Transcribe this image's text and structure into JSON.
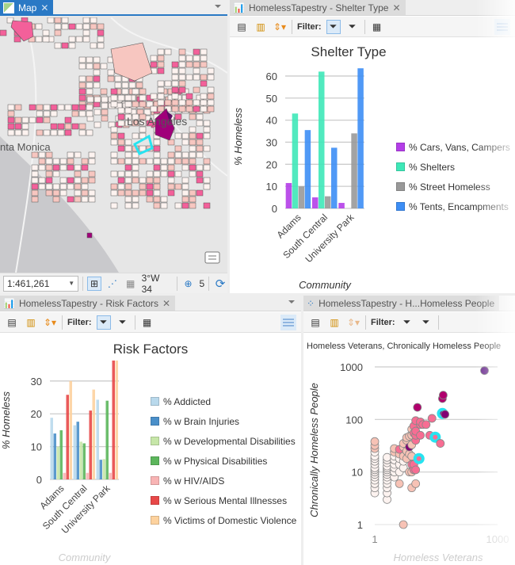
{
  "map_pane": {
    "tab_label": "Map",
    "labels": [
      "Los Angeles",
      "nta Monica"
    ],
    "scale": "1:461,261",
    "coords": "3°W 34",
    "selected_count": "5",
    "colors": {
      "accent": "#2a79c5",
      "selection": "#27e3f0"
    }
  },
  "shelter_pane": {
    "tab_label": "HomelessTapestry - Shelter Type",
    "filter_label": "Filter:",
    "chart_data": {
      "type": "bar",
      "title": "Shelter Type",
      "xlabel": "Community",
      "ylabel": "% Homeless",
      "categories": [
        "Adams",
        "South Central",
        "University Park"
      ],
      "ylim": [
        0,
        65
      ],
      "yticks": [
        "0",
        "10",
        "20",
        "30",
        "40",
        "50",
        "60"
      ],
      "grid": true,
      "legend_position": "right",
      "series": [
        {
          "name": "% Cars, Vans, Campers",
          "color": "#b43ee8",
          "values": [
            11.5,
            5,
            2.5
          ]
        },
        {
          "name": "% Shelters",
          "color": "#3ee8b8",
          "values": [
            43,
            62,
            0
          ]
        },
        {
          "name": "% Street Homeless",
          "color": "#999999",
          "values": [
            10,
            5.5,
            34
          ]
        },
        {
          "name": "% Tents, Encampments",
          "color": "#3d8ef5",
          "values": [
            35.5,
            27.5,
            63.5
          ]
        }
      ]
    }
  },
  "risk_pane": {
    "tab_label": "HomelessTapestry - Risk Factors",
    "filter_label": "Filter:",
    "chart_data": {
      "type": "bar",
      "title": "Risk Factors",
      "xlabel": "Community",
      "ylabel": "% Homeless",
      "categories": [
        "Adams",
        "South Central",
        "University Park"
      ],
      "ylim": [
        0,
        36
      ],
      "yticks": [
        "0",
        "10",
        "20",
        "30"
      ],
      "grid": true,
      "legend_position": "right",
      "series": [
        {
          "name": "% Addicted",
          "color": "#b9d9ec",
          "values": [
            18.8,
            16.5,
            24.3
          ]
        },
        {
          "name": "% w Brain Injuries",
          "color": "#4a8fc9",
          "values": [
            14,
            17.6,
            6
          ]
        },
        {
          "name": "% w Developmental Disabilities",
          "color": "#c6e6a8",
          "values": [
            10,
            11.5,
            6.2
          ]
        },
        {
          "name": "% w Physical Disabilities",
          "color": "#5cb65c",
          "values": [
            15,
            11,
            24
          ]
        },
        {
          "name": "% w HIV/AIDS",
          "color": "#f8b4b4",
          "values": [
            2,
            2,
            2
          ]
        },
        {
          "name": "% w Serious Mental Illnesses",
          "color": "#e84848",
          "values": [
            25.8,
            21,
            37
          ]
        },
        {
          "name": "% Victims of Domestic Violence",
          "color": "#fdd29e",
          "values": [
            30,
            27.4,
            36.8
          ]
        }
      ]
    }
  },
  "scatter_pane": {
    "tab_label": "HomelessTapestry - H...Homeless People",
    "filter_label": "Filter:",
    "chart_data": {
      "type": "scatter",
      "title": "Homeless Veterans, Chronically Homeless People",
      "xlabel": "Homeless Veterans",
      "ylabel": "Chronically Homeless People",
      "xscale": "log",
      "yscale": "log",
      "xlim": [
        1,
        1000
      ],
      "ylim": [
        1,
        1000
      ],
      "xticks": [
        "1",
        "1000"
      ],
      "yticks": [
        "1",
        "10",
        "100",
        "1000"
      ],
      "points": [
        {
          "x": 1,
          "y": 4,
          "c": "#fdf3f0"
        },
        {
          "x": 1,
          "y": 5,
          "c": "#fdf3f0"
        },
        {
          "x": 1,
          "y": 6,
          "c": "#fdf3f0"
        },
        {
          "x": 1,
          "y": 7,
          "c": "#fdf3f0"
        },
        {
          "x": 1,
          "y": 8,
          "c": "#fdf3f0"
        },
        {
          "x": 1,
          "y": 9,
          "c": "#fdf3f0"
        },
        {
          "x": 1,
          "y": 10,
          "c": "#fdf3f0"
        },
        {
          "x": 1,
          "y": 11,
          "c": "#fdf3f0"
        },
        {
          "x": 1,
          "y": 12,
          "c": "#fdf3f0"
        },
        {
          "x": 1,
          "y": 14,
          "c": "#fdf3f0"
        },
        {
          "x": 1,
          "y": 16,
          "c": "#fdf3f0"
        },
        {
          "x": 1,
          "y": 18,
          "c": "#fdf3f0"
        },
        {
          "x": 1,
          "y": 20,
          "c": "#fdf3f0"
        },
        {
          "x": 1,
          "y": 24,
          "c": "#fdf3f0"
        },
        {
          "x": 1,
          "y": 28,
          "c": "#f7c2b5"
        },
        {
          "x": 1,
          "y": 32,
          "c": "#f7c2b5"
        },
        {
          "x": 1,
          "y": 38,
          "c": "#f7c2b5"
        },
        {
          "x": 2,
          "y": 3,
          "c": "#fdf3f0"
        },
        {
          "x": 2,
          "y": 4,
          "c": "#fdf3f0"
        },
        {
          "x": 2,
          "y": 5,
          "c": "#fdf3f0"
        },
        {
          "x": 2,
          "y": 6,
          "c": "#fdf3f0"
        },
        {
          "x": 2,
          "y": 7,
          "c": "#fdf3f0"
        },
        {
          "x": 2,
          "y": 8,
          "c": "#fdf3f0"
        },
        {
          "x": 2,
          "y": 9,
          "c": "#fdf3f0"
        },
        {
          "x": 2,
          "y": 10,
          "c": "#fdf3f0"
        },
        {
          "x": 2,
          "y": 11,
          "c": "#fdf3f0"
        },
        {
          "x": 2,
          "y": 12,
          "c": "#fdf3f0"
        },
        {
          "x": 2,
          "y": 13,
          "c": "#fdf3f0"
        },
        {
          "x": 2,
          "y": 15,
          "c": "#fdf3f0"
        },
        {
          "x": 2,
          "y": 17,
          "c": "#fdf3f0"
        },
        {
          "x": 2,
          "y": 19,
          "c": "#fdf3f0"
        },
        {
          "x": 3,
          "y": 8,
          "c": "#fdf3f0"
        },
        {
          "x": 3,
          "y": 10,
          "c": "#fdf3f0"
        },
        {
          "x": 3,
          "y": 12,
          "c": "#fdf3f0"
        },
        {
          "x": 3,
          "y": 14,
          "c": "#fdf3f0"
        },
        {
          "x": 3,
          "y": 17,
          "c": "#fdf3f0"
        },
        {
          "x": 3,
          "y": 20,
          "c": "#fdf3f0"
        },
        {
          "x": 3,
          "y": 24,
          "c": "#f7c2b5"
        },
        {
          "x": 3,
          "y": 28,
          "c": "#f7c2b5"
        },
        {
          "x": 4,
          "y": 10,
          "c": "#fdf3f0"
        },
        {
          "x": 4,
          "y": 14,
          "c": "#fdf3f0"
        },
        {
          "x": 4,
          "y": 18,
          "c": "#fdf3f0"
        },
        {
          "x": 4,
          "y": 22,
          "c": "#f7c2b5"
        },
        {
          "x": 4,
          "y": 27,
          "c": "#f76d93"
        },
        {
          "x": 4,
          "y": 6,
          "c": "#f7c2b5"
        },
        {
          "x": 5,
          "y": 12,
          "c": "#fdf3f0"
        },
        {
          "x": 5,
          "y": 16,
          "c": "#fdf3f0"
        },
        {
          "x": 5,
          "y": 20,
          "c": "#f7c2b5"
        },
        {
          "x": 5,
          "y": 30,
          "c": "#f7c2b5"
        },
        {
          "x": 5,
          "y": 35,
          "c": "#f7c2b5"
        },
        {
          "x": 5,
          "y": 1,
          "c": "#f7c2b5"
        },
        {
          "x": 6,
          "y": 18,
          "c": "#f7c2b5"
        },
        {
          "x": 6,
          "y": 25,
          "c": "#f7c2b5"
        },
        {
          "x": 6,
          "y": 40,
          "c": "#f7c2b5"
        },
        {
          "x": 6,
          "y": 45,
          "c": "#f7c2b5"
        },
        {
          "x": 7,
          "y": 10,
          "c": "#f7c2b5"
        },
        {
          "x": 7,
          "y": 22,
          "c": "#f7c2b5"
        },
        {
          "x": 7,
          "y": 30,
          "c": "#820073"
        },
        {
          "x": 7,
          "y": 48,
          "c": "#f7c2b5"
        },
        {
          "x": 8,
          "y": 14,
          "c": "#f76d93"
        },
        {
          "x": 8,
          "y": 20,
          "c": "#f7c2b5"
        },
        {
          "x": 8,
          "y": 33,
          "c": "#f7c2b5"
        },
        {
          "x": 8,
          "y": 50,
          "c": "#f7c2b5"
        },
        {
          "x": 8,
          "y": 65,
          "c": "#f7c2b5"
        },
        {
          "x": 8,
          "y": 5,
          "c": "#f7c2b5"
        },
        {
          "x": 8,
          "y": 10,
          "c": "#f7c2b5"
        },
        {
          "x": 9,
          "y": 11,
          "c": "#f76d93"
        },
        {
          "x": 9,
          "y": 14,
          "c": "#f76d93"
        },
        {
          "x": 9,
          "y": 55,
          "c": "#f76d93"
        },
        {
          "x": 9,
          "y": 75,
          "c": "#f76d93"
        },
        {
          "x": 10,
          "y": 40,
          "c": "#f76d93"
        },
        {
          "x": 10,
          "y": 50,
          "c": "#f76d93"
        },
        {
          "x": 10,
          "y": 60,
          "c": "#f76d93"
        },
        {
          "x": 10,
          "y": 95,
          "c": "#f76d93"
        },
        {
          "x": 10,
          "y": 6,
          "c": "#f7c2b5"
        },
        {
          "x": 10,
          "y": 11,
          "c": "#f76d93"
        },
        {
          "x": 11,
          "y": 170,
          "c": "#b0006d"
        },
        {
          "x": 13,
          "y": 50,
          "c": "#f76d93"
        },
        {
          "x": 13,
          "y": 80,
          "c": "#f76d93"
        },
        {
          "x": 13,
          "y": 90,
          "c": "#f76d93"
        },
        {
          "x": 15,
          "y": 80,
          "c": "#f76d93"
        },
        {
          "x": 18,
          "y": 80,
          "c": "#f76d93"
        },
        {
          "x": 22,
          "y": 50,
          "c": "#f76d93"
        },
        {
          "x": 25,
          "y": 105,
          "c": "#f76d93"
        },
        {
          "x": 30,
          "y": 46,
          "c": "#f76d93",
          "sel": true
        },
        {
          "x": 12,
          "y": 18,
          "c": "#f76d93",
          "sel": true
        },
        {
          "x": 40,
          "y": 35,
          "c": "#f76d93"
        },
        {
          "x": 45,
          "y": 250,
          "c": "#b0006d"
        },
        {
          "x": 47,
          "y": 290,
          "c": "#b0006d"
        },
        {
          "x": 45,
          "y": 130,
          "c": "#820073",
          "sel": true
        },
        {
          "x": 52,
          "y": 125,
          "c": "#820073"
        },
        {
          "x": 480,
          "y": 850,
          "c": "#6b2c8f"
        }
      ]
    }
  }
}
